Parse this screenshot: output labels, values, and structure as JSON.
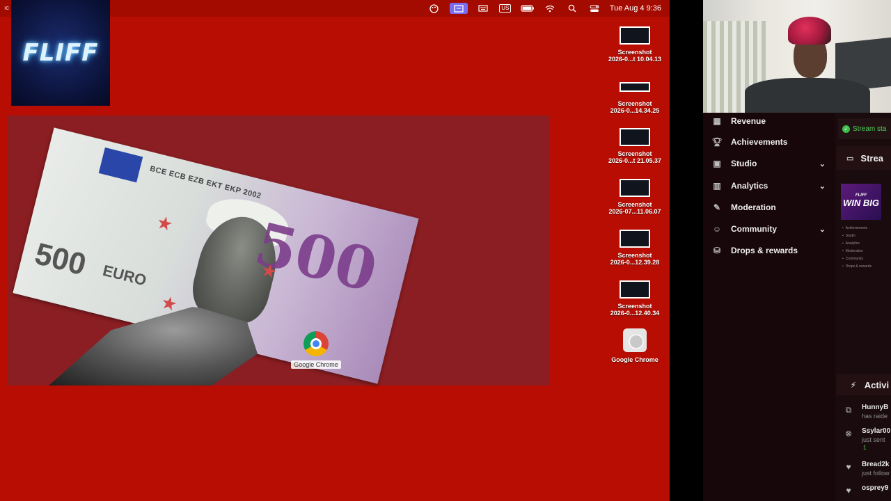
{
  "menubar": {
    "left_fragment": "ıc",
    "kbd_label": "US",
    "clock": "Tue Aug 4  9:36"
  },
  "logo": {
    "text": "FLIFF"
  },
  "banknote": {
    "letters": "BCE ECB EZB EKT EKP 2002",
    "big_value": "500",
    "small_value": "500",
    "currency": "EURO"
  },
  "dragged_icon": {
    "label": "Google Chrome"
  },
  "desktop_icons": [
    {
      "name": "Screenshot",
      "sub": "2026-0...t 10.04.13"
    },
    {
      "name": "Screenshot",
      "sub": "2026-0...14.34.25"
    },
    {
      "name": "Screenshot",
      "sub": "2026-0...t 21.05.37"
    },
    {
      "name": "Screenshot",
      "sub": "2026-07...11.06.07"
    },
    {
      "name": "Screenshot",
      "sub": "2026-0...12.39.28"
    },
    {
      "name": "Screenshot",
      "sub": "2026-0...12.40.34"
    },
    {
      "name": "Google Chrome",
      "sub": ""
    }
  ],
  "sidebar": {
    "items": [
      {
        "label": "Revenue",
        "icon": "revenue-icon",
        "expandable": false
      },
      {
        "label": "Achievements",
        "icon": "trophy-icon",
        "expandable": false
      },
      {
        "label": "Studio",
        "icon": "studio-icon",
        "expandable": true
      },
      {
        "label": "Analytics",
        "icon": "analytics-icon",
        "expandable": true
      },
      {
        "label": "Moderation",
        "icon": "wrench-icon",
        "expandable": false
      },
      {
        "label": "Community",
        "icon": "community-icon",
        "expandable": true
      },
      {
        "label": "Drops & rewards",
        "icon": "drops-icon",
        "expandable": false
      }
    ]
  },
  "right_panel": {
    "status": "Stream sta",
    "stream_header": "Strea",
    "thumb_title": "WIN BIG",
    "thumb_brand": "FLIFF",
    "mini_items": [
      "Achievements",
      "Studio",
      "Analytics",
      "Moderation",
      "Community",
      "Drops & rewards"
    ],
    "activity_header": "Activi",
    "activity": [
      {
        "name": "HunnyB",
        "sub": "has raide",
        "icon": "raid-icon",
        "badge": ""
      },
      {
        "name": "Ssylar00",
        "sub": "just sent",
        "icon": "gift-icon",
        "badge": "1"
      },
      {
        "name": "Bread2k",
        "sub": "just follow",
        "icon": "heart-icon",
        "badge": ""
      },
      {
        "name": "osprey9",
        "sub": "",
        "icon": "heart-icon",
        "badge": ""
      }
    ]
  },
  "colors": {
    "desktop_bg": "#b80d02",
    "panel_bg": "#8b1e22",
    "sidebar_bg": "#18070a",
    "status_green": "#4fd15c"
  }
}
